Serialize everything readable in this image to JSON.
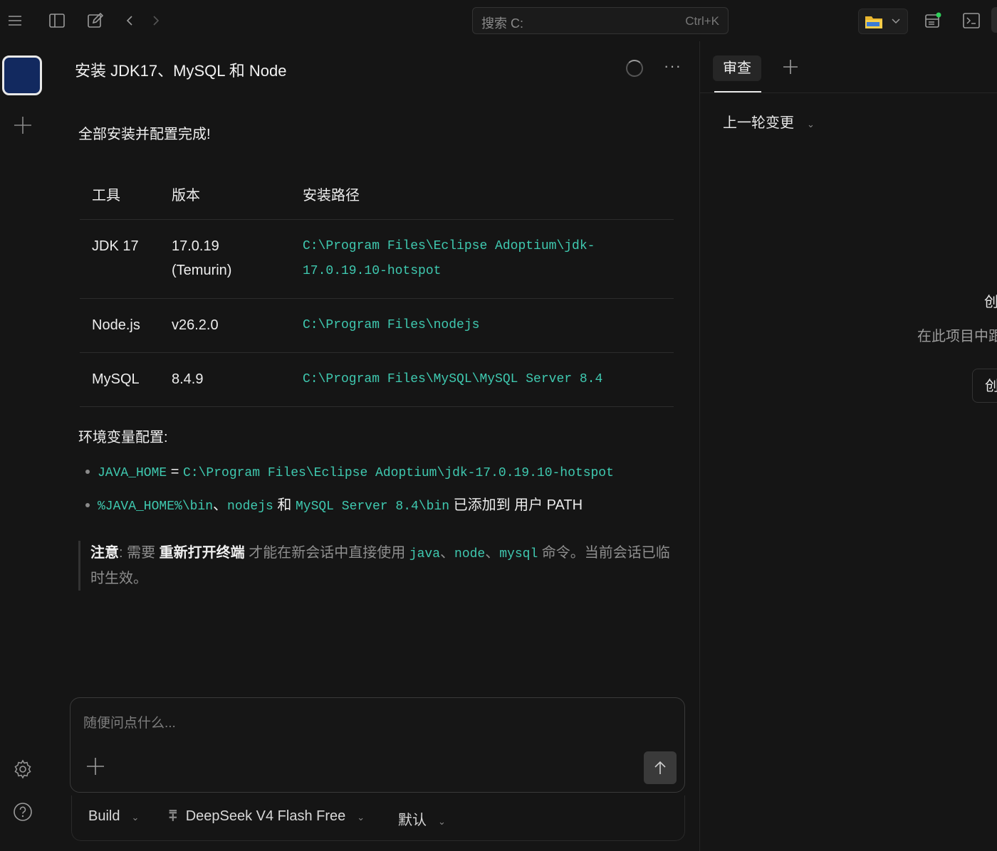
{
  "topbar": {
    "search_placeholder": "搜索 C:",
    "search_shortcut": "Ctrl+K",
    "icons": [
      "menu-icon",
      "sidebar-icon",
      "edit-icon",
      "back-icon",
      "forward-icon",
      "folder-icon",
      "chevron-down-icon",
      "panel-icon",
      "terminal-icon"
    ]
  },
  "chat": {
    "title": "安装 JDK17、MySQL 和 Node",
    "done_message": "全部安装并配置完成!",
    "table": {
      "headers": [
        "工具",
        "版本",
        "安装路径"
      ],
      "rows": [
        {
          "tool": "JDK 17",
          "version_line1": "17.0.19",
          "version_line2": "(Temurin)",
          "path_line1": "C:\\Program Files\\Eclipse Adoptium\\jdk-",
          "path_line2": "17.0.19.10-hotspot"
        },
        {
          "tool": "Node.js",
          "version_line1": "v26.2.0",
          "path_line1": "C:\\Program Files\\nodejs"
        },
        {
          "tool": "MySQL",
          "version_line1": "8.4.9",
          "path_line1": "C:\\Program Files\\MySQL\\MySQL Server 8.4"
        }
      ]
    },
    "env_title": "环境变量配置:",
    "env": {
      "item1_var": "JAVA_HOME",
      "item1_eq": " = ",
      "item1_value": "C:\\Program Files\\Eclipse Adoptium\\jdk-17.0.19.10-hotspot",
      "item2_code1": "%JAVA_HOME%\\bin",
      "item2_sep1": "、",
      "item2_code2": "nodejs",
      "item2_and": " 和 ",
      "item2_code3": "MySQL Server 8.4\\bin",
      "item2_tail": " 已添加到 用户 PATH"
    },
    "note": {
      "label": "注意",
      "colon": ": 需要 ",
      "emphasis": "重新打开终端",
      "mid": " 才能在新会话中直接使用 ",
      "cmd1": "java",
      "sep1": "、",
      "cmd2": "node",
      "sep2": "、",
      "cmd3": "mysql",
      "tail": " 命令。当前会话已临时生效。"
    }
  },
  "composer": {
    "placeholder": "随便问点什么...",
    "mode": "Build",
    "model": "DeepSeek V4 Flash Free",
    "variant": "默认"
  },
  "right_panel": {
    "tab_review": "审查",
    "changes_dropdown": "上一轮变更",
    "cut_text1": "创",
    "cut_text2": "在此项目中跟",
    "cut_button": "创"
  },
  "colors": {
    "accent_code": "#3fc9b0",
    "workspace": "#12295f",
    "background": "#151515"
  }
}
